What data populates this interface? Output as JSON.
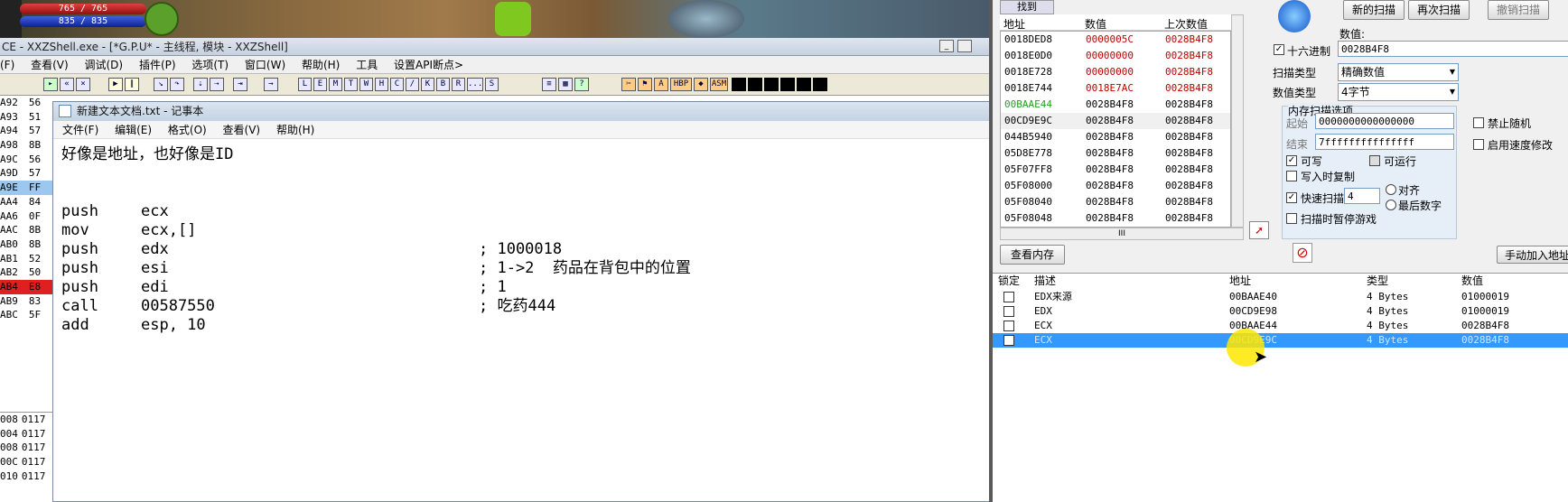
{
  "game": {
    "hp_text": "765 / 765",
    "mp_text": "835 / 835"
  },
  "od": {
    "title": "CE - XXZShell.exe - [*G.P.U* - 主线程, 模块 - XXZShell]",
    "menu": [
      "(F)",
      "查看(V)",
      "调试(D)",
      "插件(P)",
      "选项(T)",
      "窗口(W)",
      "帮助(H)",
      "工具",
      "设置API断点>"
    ],
    "toolbar_letters": [
      "L",
      "E",
      "M",
      "T",
      "W",
      "H",
      "C",
      "/",
      "K",
      "B",
      "R",
      "...",
      "S"
    ],
    "left_rows": [
      {
        "a": "A92",
        "v": "56"
      },
      {
        "a": "A93",
        "v": "51"
      },
      {
        "a": "A94",
        "v": "57"
      },
      {
        "a": "A98",
        "v": "8B"
      },
      {
        "a": "A9C",
        "v": "56"
      },
      {
        "a": "A9D",
        "v": "57"
      },
      {
        "a": "A9E",
        "v": "FF"
      },
      {
        "a": "AA4",
        "v": "84"
      },
      {
        "a": "AA6",
        "v": "0F"
      },
      {
        "a": "AAC",
        "v": "8B"
      },
      {
        "a": "AB0",
        "v": "8B"
      },
      {
        "a": "AB1",
        "v": "52"
      },
      {
        "a": "AB2",
        "v": "50"
      },
      {
        "a": "AB4",
        "v": "E8"
      },
      {
        "a": "AB9",
        "v": "83"
      },
      {
        "a": "ABC",
        "v": "5F"
      }
    ],
    "left_bottom": [
      {
        "a": "008",
        "v": "0117"
      },
      {
        "a": "004",
        "v": "0117"
      },
      {
        "a": "008",
        "v": "0117"
      },
      {
        "a": "00C",
        "v": "0117"
      },
      {
        "a": "010",
        "v": "0117"
      }
    ]
  },
  "notepad": {
    "title": "新建文本文档.txt - 记事本",
    "menu": [
      "文件(F)",
      "编辑(E)",
      "格式(O)",
      "查看(V)",
      "帮助(H)"
    ],
    "lines": [
      {
        "op": "好像是地址，也好像是ID",
        "arg": "",
        "cm": ""
      },
      {
        "op": "",
        "arg": "",
        "cm": ""
      },
      {
        "op": "",
        "arg": "",
        "cm": ""
      },
      {
        "op": "push",
        "arg": "ecx",
        "cm": ""
      },
      {
        "op": "mov",
        "arg": "ecx,[]",
        "cm": ""
      },
      {
        "op": "push",
        "arg": "edx",
        "cm": "; 1000018"
      },
      {
        "op": "push",
        "arg": "esi",
        "cm": "; 1->2  药品在背包中的位置"
      },
      {
        "op": "push",
        "arg": "edi",
        "cm": "; 1"
      },
      {
        "op": "call",
        "arg": "00587550",
        "cm": "; 吃药444"
      },
      {
        "op": "add",
        "arg": "esp, 10",
        "cm": ""
      }
    ]
  },
  "ce": {
    "res_headers": [
      "地址",
      "数值",
      "上次数值"
    ],
    "tab_label": "找到",
    "results": [
      {
        "addr": "0018DED8",
        "val": "0000005C",
        "prev": "0028B4F8",
        "changed": true
      },
      {
        "addr": "0018E0D0",
        "val": "00000000",
        "prev": "0028B4F8",
        "changed": true
      },
      {
        "addr": "0018E728",
        "val": "00000000",
        "prev": "0028B4F8",
        "changed": true
      },
      {
        "addr": "0018E744",
        "val": "0018E7AC",
        "prev": "0028B4F8",
        "changed": true
      },
      {
        "addr": "00BAAE44",
        "val": "0028B4F8",
        "prev": "0028B4F8",
        "green": true
      },
      {
        "addr": "00CD9E9C",
        "val": "0028B4F8",
        "prev": "0028B4F8"
      },
      {
        "addr": "044B5940",
        "val": "0028B4F8",
        "prev": "0028B4F8"
      },
      {
        "addr": "05D8E778",
        "val": "0028B4F8",
        "prev": "0028B4F8"
      },
      {
        "addr": "05F07FF8",
        "val": "0028B4F8",
        "prev": "0028B4F8"
      },
      {
        "addr": "05F08000",
        "val": "0028B4F8",
        "prev": "0028B4F8"
      },
      {
        "addr": "05F08040",
        "val": "0028B4F8",
        "prev": "0028B4F8"
      },
      {
        "addr": "05F08048",
        "val": "0028B4F8",
        "prev": "0028B4F8"
      }
    ],
    "new_scan": "新的扫描",
    "next_scan": "再次扫描",
    "undo_scan": "撤销扫描",
    "value_label": "数值:",
    "hex_label": "十六进制",
    "value_input": "0028B4F8",
    "scan_type_label": "扫描类型",
    "scan_type": "精确数值",
    "value_type_label": "数值类型",
    "value_type": "4字节",
    "mem_opts_title": "内存扫描选项",
    "start_label": "起始",
    "start_value": "0000000000000000",
    "stop_label": "结束",
    "stop_value": "7fffffffffffffff",
    "writable": "可写",
    "executable": "可运行",
    "copy_on_write": "写入时复制",
    "fast_scan": "快速扫描",
    "fast_scan_value": "4",
    "align": "对齐",
    "last_digits": "最后数字",
    "pause_game": "扫描时暂停游戏",
    "no_random": "禁止随机",
    "speedhack": "启用速度修改",
    "view_memory": "查看内存",
    "add_manual": "手动加入地址",
    "table_headers": [
      "锁定",
      "描述",
      "地址",
      "类型",
      "数值"
    ],
    "table_rows": [
      {
        "desc": "EDX来源",
        "addr": "00BAAE40",
        "type": "4 Bytes",
        "val": "01000019"
      },
      {
        "desc": "EDX",
        "addr": "00CD9E98",
        "type": "4 Bytes",
        "val": "01000019"
      },
      {
        "desc": "ECX",
        "addr": "00BAAE44",
        "type": "4 Bytes",
        "val": "0028B4F8"
      },
      {
        "desc": "ECX",
        "addr": "00CD9E9C",
        "type": "4 Bytes",
        "val": "0028B4F8"
      }
    ]
  }
}
